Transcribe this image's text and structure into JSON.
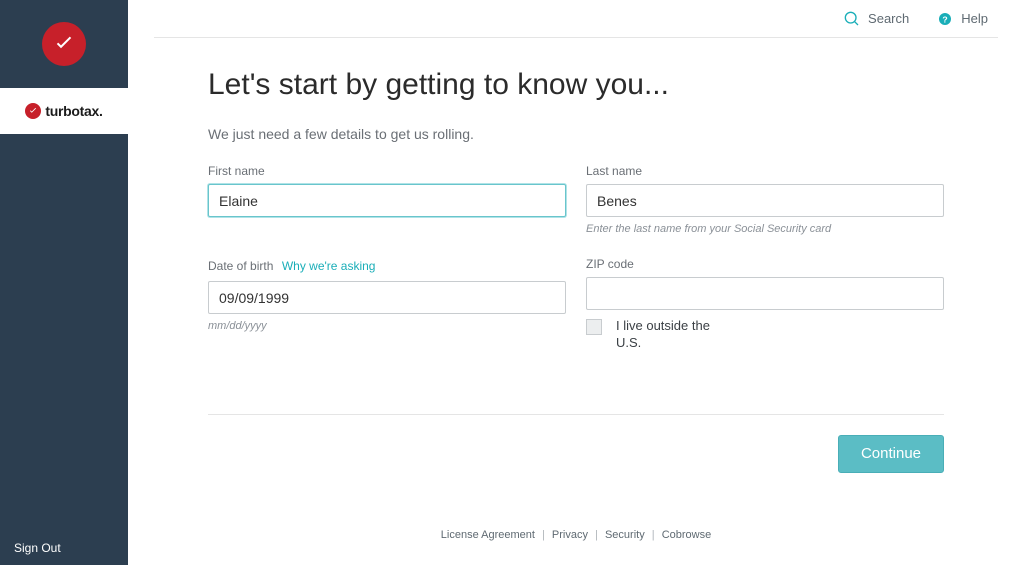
{
  "brand": {
    "name": "turbotax."
  },
  "sidebar": {
    "signout_label": "Sign Out"
  },
  "topbar": {
    "search_label": "Search",
    "help_label": "Help"
  },
  "page": {
    "title": "Let's start by getting to know you...",
    "subtitle": "We just need a few details to get us rolling."
  },
  "form": {
    "first_name": {
      "label": "First name",
      "value": "Elaine"
    },
    "last_name": {
      "label": "Last name",
      "value": "Benes",
      "hint": "Enter the last name from your Social Security card"
    },
    "dob": {
      "label": "Date of birth",
      "help_link": "Why we're asking",
      "value": "09/09/1999",
      "hint": "mm/dd/yyyy"
    },
    "zip": {
      "label": "ZIP code",
      "value": ""
    },
    "outside_us": {
      "label": "I live outside the U.S.",
      "checked": false
    }
  },
  "actions": {
    "continue_label": "Continue"
  },
  "footer": {
    "links": {
      "license": "License Agreement",
      "privacy": "Privacy",
      "security": "Security",
      "cobrowse": "Cobrowse"
    }
  }
}
